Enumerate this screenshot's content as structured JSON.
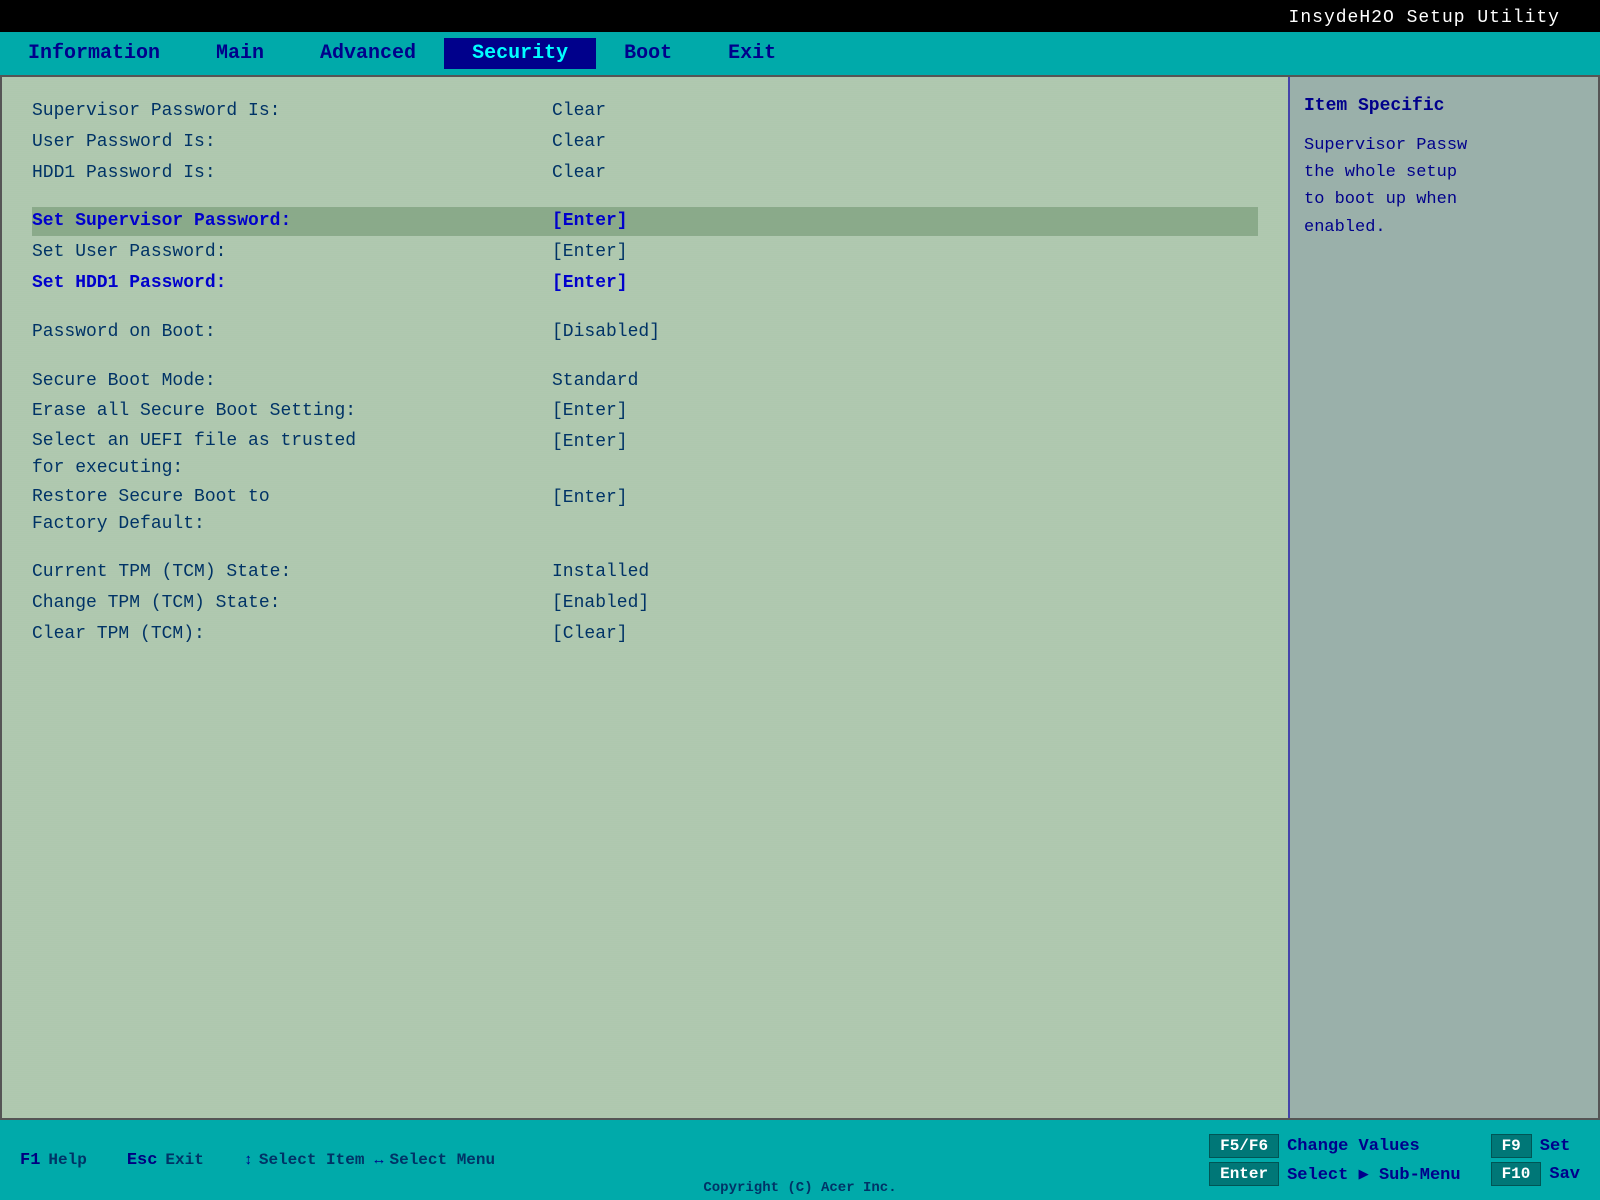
{
  "app": {
    "title": "InsydeH2O Setup Utility"
  },
  "menu": {
    "items": [
      {
        "id": "information",
        "label": "Information",
        "active": false
      },
      {
        "id": "main",
        "label": "Main",
        "active": false
      },
      {
        "id": "advanced",
        "label": "Advanced",
        "active": false
      },
      {
        "id": "security",
        "label": "Security",
        "active": true
      },
      {
        "id": "boot",
        "label": "Boot",
        "active": false
      },
      {
        "id": "exit",
        "label": "Exit",
        "active": false
      }
    ]
  },
  "settings": {
    "rows": [
      {
        "label": "Supervisor Password Is:",
        "value": "Clear",
        "highlight": false,
        "selected": false
      },
      {
        "label": "User Password Is:",
        "value": "Clear",
        "highlight": false,
        "selected": false
      },
      {
        "label": "HDD1 Password Is:",
        "value": "Clear",
        "highlight": false,
        "selected": false
      },
      {
        "spacer": true
      },
      {
        "label": "Set Supervisor Password:",
        "value": "[Enter]",
        "highlight": true,
        "selected": true
      },
      {
        "label": "Set User Password:",
        "value": "[Enter]",
        "highlight": false,
        "selected": false
      },
      {
        "label": "Set HDD1 Password:",
        "value": "[Enter]",
        "highlight": true,
        "selected": false
      },
      {
        "spacer": true
      },
      {
        "label": "Password on Boot:",
        "value": "[Disabled]",
        "highlight": false,
        "selected": false
      },
      {
        "spacer": true
      },
      {
        "label": "Secure Boot Mode:",
        "value": "Standard",
        "highlight": false,
        "selected": false
      },
      {
        "label": "Erase all Secure Boot Setting:",
        "value": "[Enter]",
        "highlight": false,
        "selected": false
      },
      {
        "label": "Select an UEFI file as trusted\nfor executing:",
        "value": "[Enter]",
        "highlight": false,
        "selected": false,
        "multiline": true
      },
      {
        "label": "Restore Secure Boot to\nFactory Default:",
        "value": "[Enter]",
        "highlight": false,
        "selected": false,
        "multiline2": true
      },
      {
        "spacer": true
      },
      {
        "label": "Current TPM (TCM) State:",
        "value": "Installed",
        "highlight": false,
        "selected": false
      },
      {
        "label": "Change TPM (TCM) State:",
        "value": "[Enabled]",
        "highlight": false,
        "selected": false
      },
      {
        "label": "Clear TPM (TCM):",
        "value": "[Clear]",
        "highlight": false,
        "selected": false
      }
    ]
  },
  "right_panel": {
    "title": "Item Specific",
    "description": "Supervisor Passw the whole setup to boot up when enabled."
  },
  "bottom_bar": {
    "f1_key": "F1",
    "f1_desc": "Help",
    "esc_key": "Esc",
    "esc_desc": "Exit",
    "up_down_desc": "Select Item",
    "left_right_desc": "Select Menu",
    "f5f6_key": "F5/F6",
    "f5f6_desc": "Change Values",
    "enter_key": "Enter",
    "enter_desc": "Select ▶ Sub-Menu",
    "f9_key": "F9",
    "f9_desc": "Set",
    "f10_key": "F10",
    "f10_desc": "Sav",
    "copyright": "Copyright (C) Acer Inc."
  }
}
